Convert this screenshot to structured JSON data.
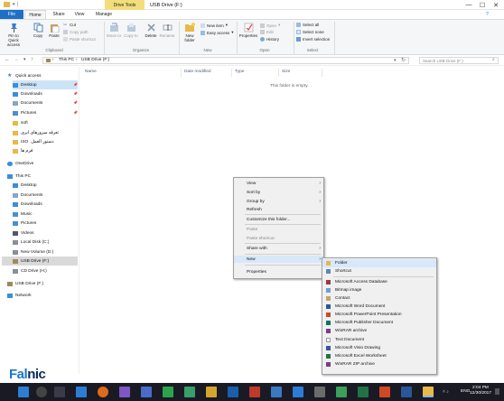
{
  "window": {
    "title": "USB Drive (F:)",
    "context_tab": "Drive Tools",
    "controls": {
      "minimize": "—",
      "maximize": "☐",
      "close": "✕"
    }
  },
  "ribbon_tabs": [
    "File",
    "Home",
    "Share",
    "View",
    "Manage"
  ],
  "ribbon": {
    "clipboard": {
      "pin": "Pin to Quick access",
      "copy": "Copy",
      "paste": "Paste",
      "cut": "Cut",
      "copy_path": "Copy path",
      "paste_shortcut": "Paste shortcut",
      "group": "Clipboard"
    },
    "organize": {
      "move_to": "Move to",
      "copy_to": "Copy to",
      "delete": "Delete",
      "rename": "Rename",
      "group": "Organize"
    },
    "new": {
      "new_folder": "New folder",
      "new_item": "New item",
      "easy_access": "Easy access",
      "group": "New"
    },
    "open": {
      "properties": "Properties",
      "open": "Open",
      "edit": "Edit",
      "history": "History",
      "group": "Open"
    },
    "select": {
      "select_all": "Select all",
      "select_none": "Select none",
      "invert": "Invert selection",
      "group": "Select"
    }
  },
  "address": {
    "path": [
      "This PC",
      "USB Drive (F:)"
    ],
    "search_placeholder": "Search USB Drive (F:)"
  },
  "nav": {
    "quick_access": "Quick access",
    "items": [
      "Desktop",
      "Downloads",
      "Documents",
      "Pictures",
      "soft",
      "تعرفه سرورهای ابری",
      "ISO",
      "دستور العمل",
      "فرم ها"
    ],
    "onedrive": "OneDrive",
    "this_pc": "This PC",
    "pc_items": [
      "Desktop",
      "Documents",
      "Downloads",
      "Music",
      "Pictures",
      "Videos",
      "Local Disk (C:)",
      "New Volume (D:)",
      "USB Drive (F:)",
      "CD Drive (H:)"
    ],
    "usb": "USB Drive (F:)",
    "network": "Network"
  },
  "columns": {
    "name": "Name",
    "date": "Date modified",
    "type": "Type",
    "size": "Size"
  },
  "empty_message": "This folder is empty.",
  "context_menu": {
    "items": [
      "View",
      "Sort by",
      "Group by",
      "Refresh",
      "Customize this folder...",
      "Paste",
      "Paste shortcut",
      "Share with",
      "New",
      "Properties"
    ]
  },
  "new_submenu": {
    "items": [
      "Folder",
      "Shortcut",
      "Microsoft Access Database",
      "Bitmap image",
      "Contact",
      "Microsoft Word Document",
      "Microsoft PowerPoint Presentation",
      "Microsoft Publisher Document",
      "WinRAR archive",
      "Text Document",
      "Microsoft Visio Drawing",
      "Microsoft Excel Worksheet",
      "WinRAR ZIP archive"
    ]
  },
  "taskbar": {
    "language": "ENG",
    "time": "2:04 PM",
    "date": "12/30/2017"
  },
  "watermark": {
    "part1": "Fal",
    "part2": "nic"
  },
  "colors": {
    "accent": "#1f6fc5",
    "drive_tools": "#f3dd7a",
    "taskbar": "#1a1a24",
    "folder": "#e8b84a"
  }
}
